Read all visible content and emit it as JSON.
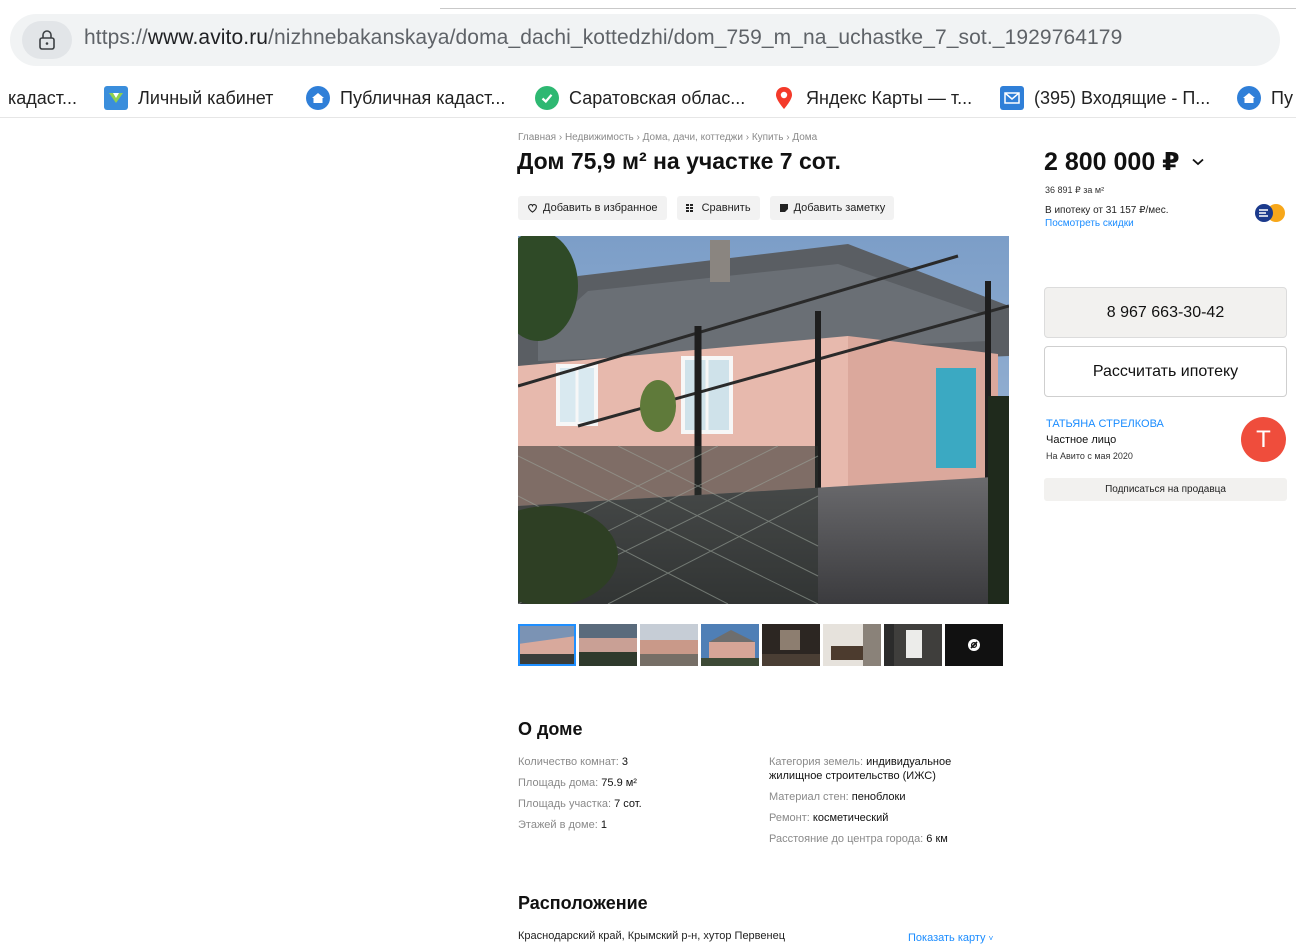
{
  "browser": {
    "url_scheme": "https://",
    "url_host": "www.avito.ru",
    "url_path": "/nizhnebakanskaya/doma_dachi_kottedzhi/dom_759_m_na_uchastke_7_sot._1929764179",
    "bookmarks": [
      {
        "label": "кадаст...",
        "icon": "none"
      },
      {
        "label": "Личный кабинет",
        "icon": "gosuslugi-icon"
      },
      {
        "label": "Публичная кадаст...",
        "icon": "house-icon"
      },
      {
        "label": "Саратовская облас...",
        "icon": "check-icon"
      },
      {
        "label": "Яндекс Карты — т...",
        "icon": "map-pin-icon"
      },
      {
        "label": "(395) Входящие - П...",
        "icon": "mail-icon"
      },
      {
        "label": "Пу",
        "icon": "house-icon"
      }
    ]
  },
  "listing": {
    "breadcrumbs": "Главная › Недвижимость › Дома, дачи, коттеджи › Купить › Дома",
    "title": "Дом 75,9 м² на участке 7 сот.",
    "actions": {
      "favorite": "Добавить в избранное",
      "compare": "Сравнить",
      "note": "Добавить заметку"
    },
    "thumbnail_count": 8
  },
  "about": {
    "heading": "О доме",
    "left": [
      {
        "label": "Количество комнат: ",
        "value": "3"
      },
      {
        "label": "Площадь дома: ",
        "value": "75.9 м²"
      },
      {
        "label": "Площадь участка: ",
        "value": "7 сот."
      },
      {
        "label": "Этажей в доме: ",
        "value": "1"
      }
    ],
    "right": [
      {
        "label": "Категория земель: ",
        "value": "индивидуальное жилищное строительство (ИЖС)"
      },
      {
        "label": "Материал стен: ",
        "value": "пеноблоки"
      },
      {
        "label": "Ремонт: ",
        "value": "косметический"
      },
      {
        "label": "Расстояние до центра города: ",
        "value": "6 км"
      }
    ]
  },
  "location": {
    "heading": "Расположение",
    "address": "Краснодарский край, Крымский р-н, хутор Первенец",
    "show_map": "Показать карту"
  },
  "sidebar": {
    "price": "2 800 000 ₽",
    "price_per_m2": "36 891 ₽ за м²",
    "mortgage": "В ипотеку от 31 157 ₽/мес.",
    "discounts_link": "Посмотреть скидки",
    "phone": "8 967 663-30-42",
    "calc_mortgage": "Рассчитать ипотеку",
    "seller_name": "ТАТЬЯНА СТРЕЛКОВА",
    "seller_type": "Частное лицо",
    "seller_since": "На Авито с мая 2020",
    "avatar_letter": "Т",
    "subscribe": "Подписаться на продавца"
  },
  "colors": {
    "link": "#1a8cff",
    "avatar": "#ef4d3c",
    "button_bg": "#f2f1ef"
  }
}
